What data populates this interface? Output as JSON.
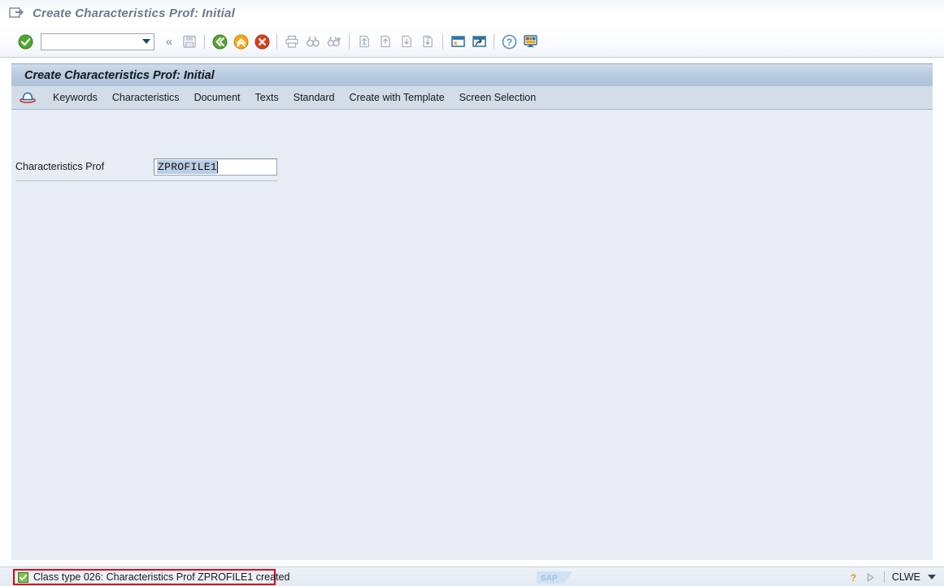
{
  "window": {
    "title": "Create Characteristics Prof: Initial",
    "title_icon": "new-window-icon"
  },
  "toolbar": {
    "enter_label": "enter-icon",
    "command_field": {
      "value": "",
      "placeholder": ""
    },
    "collapse_label": "«",
    "buttons": [
      {
        "name": "save-button",
        "icon": "floppy-disk-icon",
        "enabled": false
      },
      {
        "name": "back-button",
        "icon": "green-back-arrow-icon",
        "enabled": true
      },
      {
        "name": "exit-button",
        "icon": "yellow-up-arrow-icon",
        "enabled": true
      },
      {
        "name": "cancel-button",
        "icon": "red-cancel-icon",
        "enabled": true
      },
      {
        "name": "print-button",
        "icon": "printer-icon",
        "enabled": false
      },
      {
        "name": "find-button",
        "icon": "binoculars-icon",
        "enabled": false
      },
      {
        "name": "find-next-button",
        "icon": "binoculars-plus-icon",
        "enabled": false
      },
      {
        "name": "first-page-button",
        "icon": "first-page-icon",
        "enabled": false
      },
      {
        "name": "previous-page-button",
        "icon": "previous-page-icon",
        "enabled": false
      },
      {
        "name": "next-page-button",
        "icon": "next-page-icon",
        "enabled": false
      },
      {
        "name": "last-page-button",
        "icon": "last-page-icon",
        "enabled": false
      },
      {
        "name": "create-session-button",
        "icon": "new-session-icon",
        "enabled": true
      },
      {
        "name": "create-shortcut-button",
        "icon": "shortcut-arrow-icon",
        "enabled": true
      },
      {
        "name": "help-button",
        "icon": "question-mark-icon",
        "enabled": true
      },
      {
        "name": "layout-menu-button",
        "icon": "customize-layout-icon",
        "enabled": true
      }
    ]
  },
  "screen": {
    "title": "Create Characteristics Prof: Initial",
    "menu_icon": "hat-icon",
    "menu_items": [
      "Keywords",
      "Characteristics",
      "Document",
      "Texts",
      "Standard",
      "Create with Template",
      "Screen Selection"
    ]
  },
  "form": {
    "field_label": "Characteristics Prof",
    "field_value": "ZPROFILE1",
    "field_selected": true
  },
  "status": {
    "message": "Class type 026: Characteristics Prof ZPROFILE1 created",
    "message_icon": "green-check-icon",
    "highlight_color": "#e2001a",
    "logo": "SAP",
    "help_icon": "help-question-icon",
    "expand_icon": "play-triangle-icon",
    "system": "CLWE"
  },
  "colors": {
    "title_band": "#b7cadf",
    "menu_bar": "#d3dde8",
    "content_bg": "#e8edf5",
    "accent_green": "#4ea72e",
    "accent_red": "#e2001a"
  }
}
